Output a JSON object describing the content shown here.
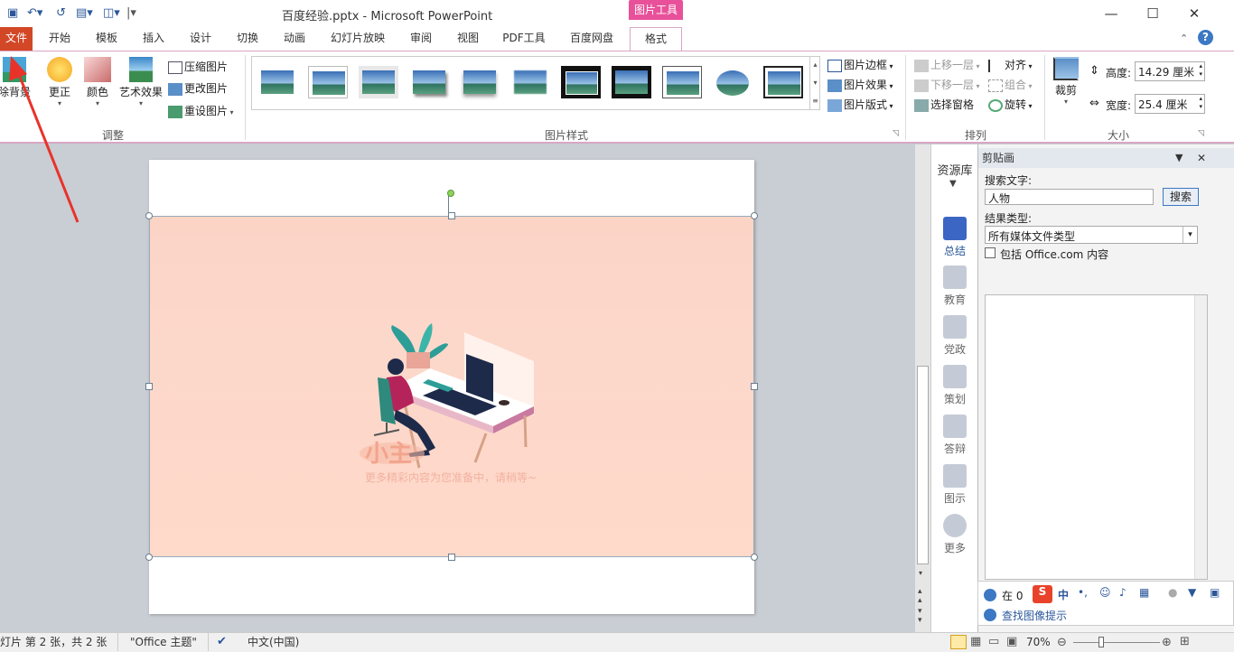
{
  "app": {
    "doc_title": "百度经验.pptx - Microsoft PowerPoint",
    "picture_tools": "图片工具"
  },
  "tabs": [
    "文件",
    "开始",
    "模板",
    "插入",
    "设计",
    "切换",
    "动画",
    "幻灯片放映",
    "审阅",
    "视图",
    "PDF工具",
    "百度网盘",
    "格式"
  ],
  "ribbon": {
    "remove_bg": "除背景",
    "correct": "更正",
    "color": "颜色",
    "artistic": "艺术效果",
    "compress": "压缩图片",
    "change": "更改图片",
    "reset": "重设图片",
    "group_adjust": "调整",
    "border": "图片边框",
    "effects": "图片效果",
    "layout": "图片版式",
    "group_styles": "图片样式",
    "bring_forward": "上移一层",
    "send_backward": "下移一层",
    "selection_pane": "选择窗格",
    "align": "对齐",
    "group": "组合",
    "rotate": "旋转",
    "group_arrange": "排列",
    "crop": "裁剪",
    "height_label": "高度:",
    "height_value": "14.29 厘米",
    "width_label": "宽度:",
    "width_value": "25.4 厘米",
    "group_size": "大小"
  },
  "slide_picture": {
    "brand": "小主",
    "caption": "更多精彩内容为您准备中，请稍等~"
  },
  "resource_pane": {
    "title": "资源库",
    "items": [
      "总结",
      "教育",
      "党政",
      "策划",
      "答辩",
      "图示",
      "更多"
    ]
  },
  "clip_pane": {
    "title": "剪贴画",
    "search_label": "搜索文字:",
    "search_value": "人物",
    "search_button": "搜索",
    "result_type_label": "结果类型:",
    "result_type_value": "所有媒体文件类型",
    "include_office": "包括 Office.com 内容",
    "tip_text": "查找图像提示",
    "in_text": "在 0"
  },
  "status": {
    "slide_info": "灯片 第 2 张，共 2 张",
    "theme": "\"Office 主题\"",
    "language": "中文(中国)",
    "zoom": "70%"
  },
  "colors": {
    "accent": "#e8519a",
    "file_tab": "#d24726",
    "picture_bg": "#fcd6c8",
    "arrow": "#e8332a"
  }
}
